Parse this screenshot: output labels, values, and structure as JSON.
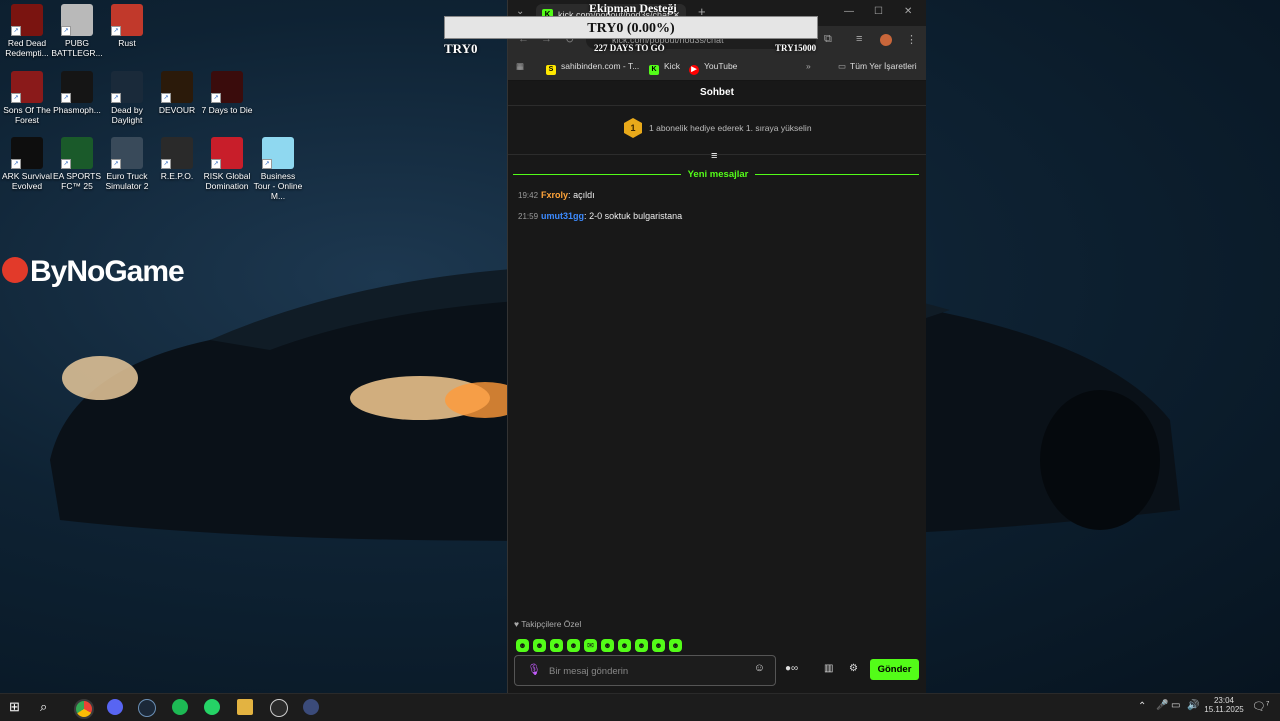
{
  "desktop": {
    "icons": [
      {
        "label": "Red Dead Redempti...",
        "color": "#7a1410"
      },
      {
        "label": "PUBG BATTLEGR...",
        "color": "#b9b9b9"
      },
      {
        "label": "Rust",
        "color": "#c1392b"
      },
      {
        "label": "Sons Of The Forest",
        "color": "#8a1a1a"
      },
      {
        "label": "Phasmoph...",
        "color": "#151515"
      },
      {
        "label": "Dead by Daylight",
        "color": "#1a2a3a"
      },
      {
        "label": "DEVOUR",
        "color": "#2b1a0a"
      },
      {
        "label": "7 Days to Die",
        "color": "#3a0c0c"
      },
      {
        "label": "ARK Survival Evolved",
        "color": "#0e0e0e"
      },
      {
        "label": "EA SPORTS FC™ 25",
        "color": "#1a5a2a"
      },
      {
        "label": "Euro Truck Simulator 2",
        "color": "#394a5a"
      },
      {
        "label": "R.E.P.O.",
        "color": "#2a2a2a"
      },
      {
        "label": "RISK Global Domination",
        "color": "#c81e2a"
      },
      {
        "label": "Business Tour - Online M...",
        "color": "#8fd8f0"
      }
    ],
    "brand": "ByNoGame"
  },
  "overlay": {
    "title": "Ekipman Desteği",
    "progress_text": "TRY0 (0.00%)",
    "progress_fraction": 0.0,
    "left_label": "TRY0",
    "center_label": "227 DAYS TO GO",
    "right_label": "TRY15000"
  },
  "browser": {
    "tab_title": "kick.com/popout/hod3s/chat",
    "url": "kick.com/popout/hod3s/chat",
    "bookmarks": [
      "sahibinden.com - T...",
      "Kick",
      "YouTube"
    ],
    "all_bookmarks": "Tüm Yer İşaretleri"
  },
  "chat": {
    "header": "Sohbet",
    "promo_rank": "1",
    "promo_text": "1 abonelik hediye ederek 1. sıraya yükselin",
    "new_messages": "Yeni mesajlar",
    "messages": [
      {
        "time": "19:42",
        "user": "Fxroly",
        "color": "#ffa43a",
        "text": "açıldı"
      },
      {
        "time": "21:59",
        "user": "umut31gg",
        "color": "#3d8bff",
        "text": "2-0 soktuk bulgaristana"
      }
    ],
    "followers_label": "Takipçilere Özel",
    "input_placeholder": "Bir mesaj gönderin",
    "send_label": "Gönder",
    "accent": "#53fc18"
  },
  "taskbar": {
    "time": "23:04",
    "date": "15.11.2025",
    "notifications": "7"
  }
}
